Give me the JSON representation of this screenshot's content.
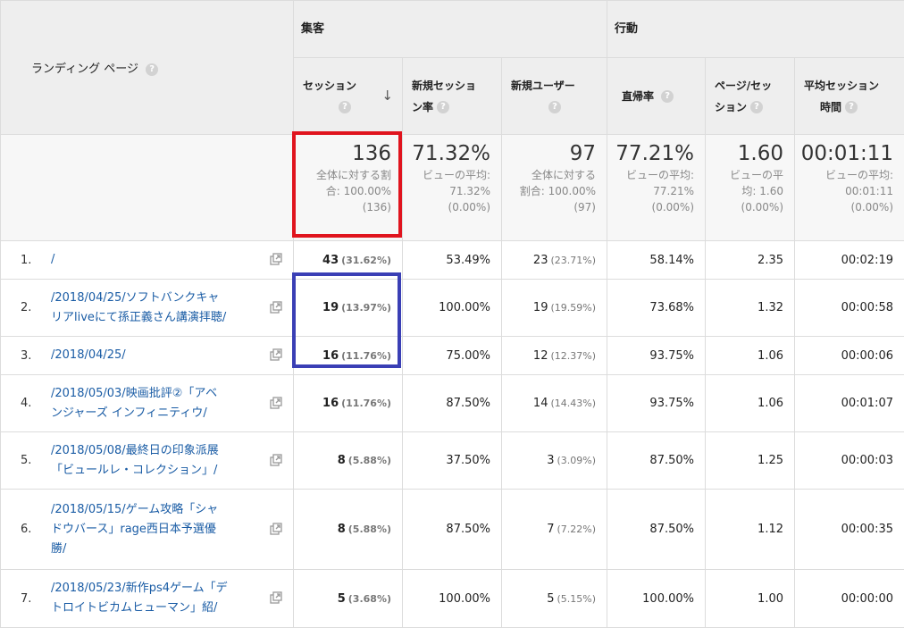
{
  "header": {
    "landing_label": "ランディング ページ",
    "group_acquisition": "集客",
    "group_behavior": "行動",
    "help_glyph": "?",
    "sort_glyph": "↓",
    "columns": [
      {
        "line1": "セッション",
        "line2": ""
      },
      {
        "line1": "新規セッショ",
        "line2": "ン率"
      },
      {
        "line1": "新規ユーザー",
        "line2": ""
      },
      {
        "line1": "直帰率",
        "line2": ""
      },
      {
        "line1": "ページ/セッ",
        "line2": "ション"
      },
      {
        "line1": "平均セッション",
        "line2": "時間"
      }
    ]
  },
  "totals": [
    {
      "big": "136",
      "sub1": "全体に対する割",
      "sub2": "合: 100.00%",
      "sub3": "(136)"
    },
    {
      "big": "71.32%",
      "sub1": "ビューの平均:",
      "sub2": "71.32%",
      "sub3": "(0.00%)"
    },
    {
      "big": "97",
      "sub1": "全体に対する",
      "sub2": "割合: 100.00%",
      "sub3": "(97)"
    },
    {
      "big": "77.21%",
      "sub1": "ビューの平均:",
      "sub2": "77.21%",
      "sub3": "(0.00%)"
    },
    {
      "big": "1.60",
      "sub1": "ビューの平",
      "sub2": "均: 1.60",
      "sub3": "(0.00%)"
    },
    {
      "big": "00:01:11",
      "sub1": "ビューの平均:",
      "sub2": "00:01:11",
      "sub3": "(0.00%)"
    }
  ],
  "rows": [
    {
      "idx": "1.",
      "l1": "/",
      "l2": "",
      "l3": "",
      "sessions": "43",
      "sessions_pct": "(31.62%)",
      "new_rate": "53.49%",
      "new_users": "23",
      "new_users_pct": "(23.71%)",
      "bounce": "58.14%",
      "pps": "2.35",
      "avg": "00:02:19"
    },
    {
      "idx": "2.",
      "l1": "/2018/04/25/ソフトバンクキャ",
      "l2": "リアliveにて孫正義さん講演拝聴/",
      "l3": "",
      "sessions": "19",
      "sessions_pct": "(13.97%)",
      "new_rate": "100.00%",
      "new_users": "19",
      "new_users_pct": "(19.59%)",
      "bounce": "73.68%",
      "pps": "1.32",
      "avg": "00:00:58"
    },
    {
      "idx": "3.",
      "l1": "/2018/04/25/",
      "l2": "",
      "l3": "",
      "sessions": "16",
      "sessions_pct": "(11.76%)",
      "new_rate": "75.00%",
      "new_users": "12",
      "new_users_pct": "(12.37%)",
      "bounce": "93.75%",
      "pps": "1.06",
      "avg": "00:00:06"
    },
    {
      "idx": "4.",
      "l1": "/2018/05/03/映画批評②「アベ",
      "l2": "ンジャーズ インフィニティウ/",
      "l3": "",
      "sessions": "16",
      "sessions_pct": "(11.76%)",
      "new_rate": "87.50%",
      "new_users": "14",
      "new_users_pct": "(14.43%)",
      "bounce": "93.75%",
      "pps": "1.06",
      "avg": "00:01:07"
    },
    {
      "idx": "5.",
      "l1": "/2018/05/08/最終日の印象派展",
      "l2": "「ビュールレ・コレクション」/",
      "l3": "",
      "sessions": "8",
      "sessions_pct": "(5.88%)",
      "new_rate": "37.50%",
      "new_users": "3",
      "new_users_pct": "(3.09%)",
      "bounce": "87.50%",
      "pps": "1.25",
      "avg": "00:00:03"
    },
    {
      "idx": "6.",
      "l1": "/2018/05/15/ゲーム攻略「シャ",
      "l2": "ドウバース」rage西日本予選優",
      "l3": "勝/",
      "sessions": "8",
      "sessions_pct": "(5.88%)",
      "new_rate": "87.50%",
      "new_users": "7",
      "new_users_pct": "(7.22%)",
      "bounce": "87.50%",
      "pps": "1.12",
      "avg": "00:00:35"
    },
    {
      "idx": "7.",
      "l1": "/2018/05/23/新作ps4ゲーム「デ",
      "l2": "トロイトビカムヒューマン」紹/",
      "l3": "",
      "sessions": "5",
      "sessions_pct": "(3.68%)",
      "new_rate": "100.00%",
      "new_users": "5",
      "new_users_pct": "(5.15%)",
      "bounce": "100.00%",
      "pps": "1.00",
      "avg": "00:00:00"
    }
  ],
  "colors": {
    "red_box": "#e0141e",
    "blue_box": "#3a3fb5",
    "link": "#1a5ca5"
  }
}
